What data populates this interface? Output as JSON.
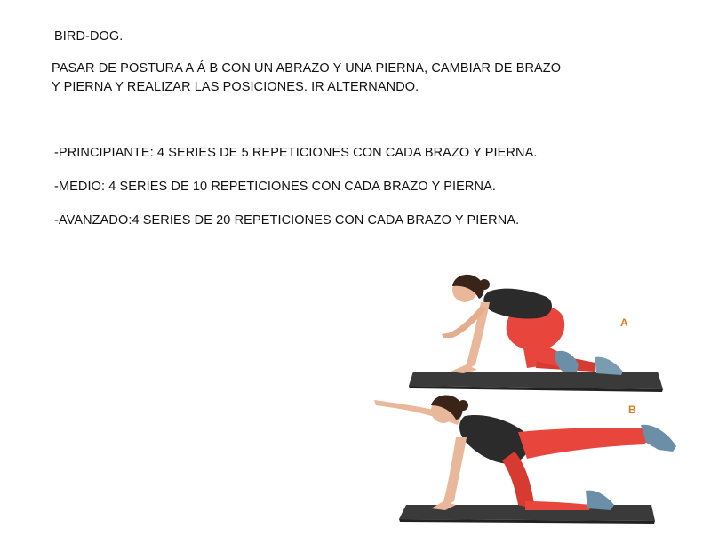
{
  "document": {
    "title": "BIRD-DOG.",
    "instructions": [
      "PASAR DE POSTURA A Á B CON UN ABRAZO Y UNA PIERNA, CAMBIAR DE BRAZO",
      "Y PIERNA Y REALIZAR LAS POSICIONES. IR ALTERNANDO."
    ],
    "levels": [
      "-PRINCIPIANTE: 4 SERIES DE 5 REPETICIONES CON CADA BRAZO Y PIERNA.",
      "-MEDIO: 4 SERIES DE 10 REPETICIONES CON CADA BRAZO Y PIERNA.",
      "-AVANZADO:4 SERIES DE 20 REPETICIONES CON CADA BRAZO Y PIERNA."
    ]
  },
  "illustration": {
    "label_a": "A",
    "label_b": "B",
    "colors": {
      "label": "#e07a1a",
      "mat": "#3a3a3a",
      "leggings": "#e8453c",
      "top": "#2b2b2b",
      "skin": "#e9b89a",
      "hair": "#3a2418",
      "shoes": "#6a8fa6"
    }
  }
}
